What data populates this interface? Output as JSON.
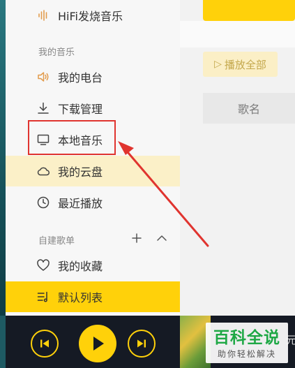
{
  "sidebar": {
    "hifi_label": "HiFi发烧音乐",
    "my_music_title": "我的音乐",
    "my_music_items": [
      {
        "label": "我的电台",
        "icon": "speaker-icon"
      },
      {
        "label": "下载管理",
        "icon": "download-icon"
      },
      {
        "label": "本地音乐",
        "icon": "monitor-icon"
      },
      {
        "label": "我的云盘",
        "icon": "cloud-icon"
      },
      {
        "label": "最近播放",
        "icon": "clock-icon"
      }
    ],
    "playlists_title": "自建歌单",
    "playlist_items": [
      {
        "label": "我的收藏",
        "icon": "heart-icon"
      },
      {
        "label": "默认列表",
        "icon": "playlist-icon"
      }
    ],
    "highlighted_item": "本地音乐"
  },
  "main": {
    "play_all_label": "播放全部",
    "column_header": "歌名"
  },
  "player": {
    "song_title_partial": "元"
  },
  "watermark": {
    "main": "百科全说",
    "sub": "助你轻松解决"
  },
  "colors": {
    "accent": "#ffd10a",
    "annotation": "#e0342f",
    "player_bg": "#151a24"
  }
}
